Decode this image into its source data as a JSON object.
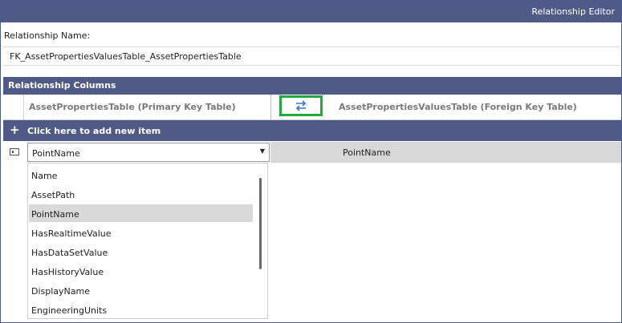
{
  "window": {
    "title": "Relationship Editor"
  },
  "relationship": {
    "name_label": "Relationship Name:",
    "name_value": "FK_AssetPropertiesValuesTable_AssetPropertiesTable"
  },
  "columns_section": {
    "title": "Relationship Columns",
    "primary_header": "AssetPropertiesTable (Primary Key Table)",
    "foreign_header": "AssetPropertiesValuesTable (Foreign Key Table)"
  },
  "add_item": {
    "plus": "+",
    "label": "Click here to add new item"
  },
  "row": {
    "primary_value": "PointName",
    "foreign_value": "PointName",
    "dropdown_arrow": "▼"
  },
  "dropdown": {
    "items": [
      "Name",
      "AssetPath",
      "PointName",
      "HasRealtimeValue",
      "HasDataSetValue",
      "HasHistoryValue",
      "DisplayName",
      "EngineeringUnits"
    ],
    "selected": "PointName"
  },
  "icons": {
    "swap": "swap-arrows-icon",
    "row_indicator": "row-indicator-icon"
  },
  "colors": {
    "header": "#4f5b86",
    "highlight": "#1faa3b",
    "swap_arrow": "#3a78c4"
  }
}
